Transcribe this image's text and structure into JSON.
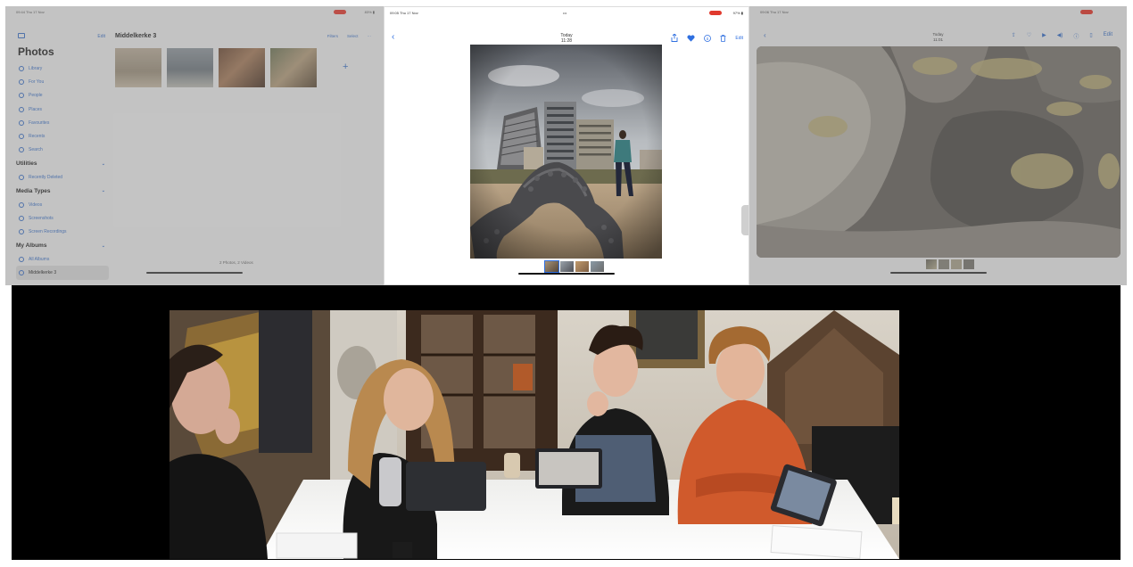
{
  "library_panel": {
    "status_time": "09:44 Thu 17 Nov",
    "status_battery": "83% ▮",
    "edit_label": "Edit",
    "title": "Photos",
    "items": [
      {
        "label": "Library",
        "type": "item"
      },
      {
        "label": "For You",
        "type": "item"
      },
      {
        "label": "People",
        "type": "item"
      },
      {
        "label": "Places",
        "type": "item"
      },
      {
        "label": "Favourites",
        "type": "item"
      },
      {
        "label": "Recents",
        "type": "item"
      },
      {
        "label": "Search",
        "type": "item"
      },
      {
        "label": "Utilities",
        "type": "head"
      },
      {
        "label": "Recently Deleted",
        "type": "item"
      },
      {
        "label": "Media Types",
        "type": "head"
      },
      {
        "label": "Videos",
        "type": "item"
      },
      {
        "label": "Screenshots",
        "type": "item"
      },
      {
        "label": "Screen Recordings",
        "type": "item"
      },
      {
        "label": "My Albums",
        "type": "head"
      },
      {
        "label": "All Albums",
        "type": "item"
      },
      {
        "label": "Middelkerke 3",
        "type": "selected"
      }
    ],
    "album_title": "Middelkerke 3",
    "actions": [
      "Filters",
      "Select",
      "···"
    ],
    "add_icon": "plus-icon",
    "footer_count": "2 Photos, 2 Videos"
  },
  "viewer_panel": {
    "status_time": "09:05 Thu 17 Nov",
    "status_battery": "97% ▮",
    "nav_date_day": "Today",
    "nav_date_time": "11:28",
    "edit_label": "Edit",
    "tools": [
      "share-icon",
      "heart-icon",
      "info-icon",
      "trash-icon"
    ]
  },
  "detail_panel": {
    "status_time": "09:06 Thu 17 Nov",
    "nav_date_day": "Today",
    "nav_date_time": "11:01",
    "edit_label": "Edit",
    "tools": [
      "share-icon",
      "heart-icon",
      "play-icon",
      "volume-icon",
      "info-icon",
      "trash-icon"
    ]
  },
  "colors": {
    "accent": "#2f6fe0",
    "record": "#e03a2e",
    "band": "#000000"
  }
}
